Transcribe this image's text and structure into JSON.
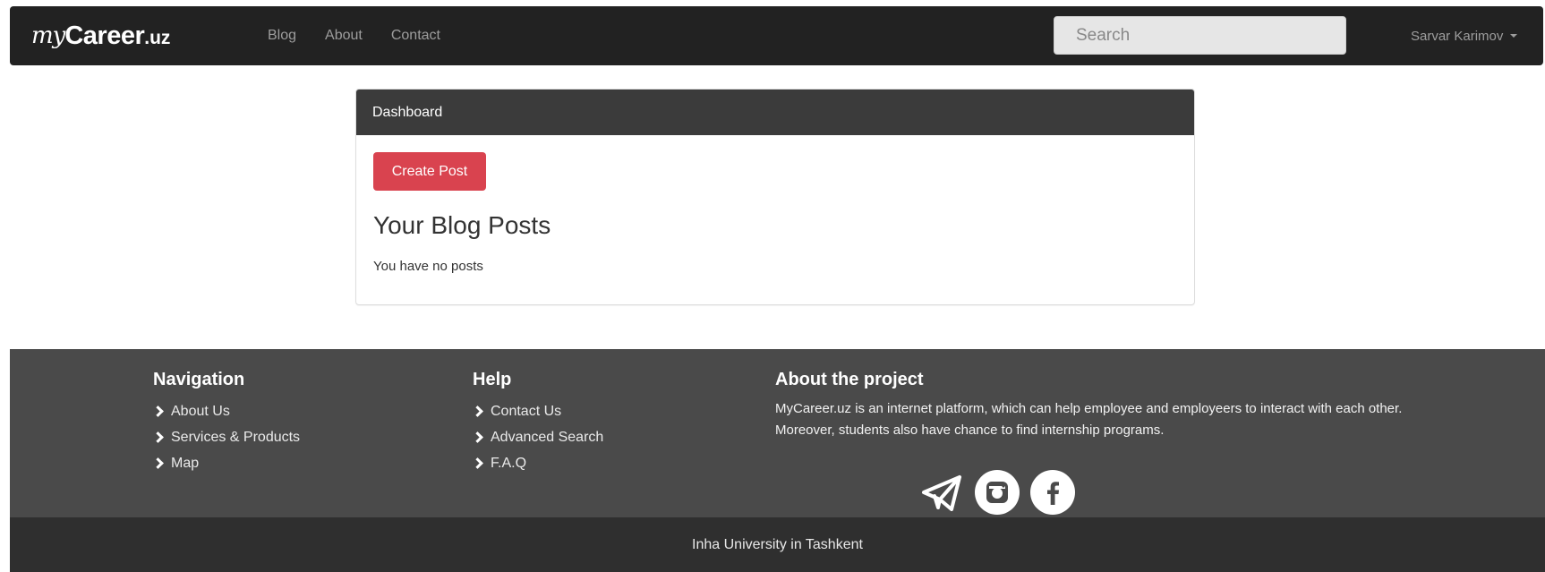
{
  "navbar": {
    "brand": {
      "my": "my",
      "career": "Career",
      "uz": ".uz"
    },
    "links": [
      "Blog",
      "About",
      "Contact"
    ],
    "search_placeholder": "Search",
    "user_name": "Sarvar Karimov"
  },
  "panel": {
    "heading": "Dashboard",
    "create_button": "Create Post",
    "posts_title": "Your Blog Posts",
    "empty_message": "You have no posts"
  },
  "footer": {
    "navigation": {
      "title": "Navigation",
      "items": [
        "About Us",
        "Services & Products",
        "Map"
      ]
    },
    "help": {
      "title": "Help",
      "items": [
        "Contact Us",
        "Advanced Search",
        "F.A.Q"
      ]
    },
    "about": {
      "title": "About the project",
      "text": "MyCareer.uz is an internet platform, which can help employee and employeers to interact with each other. Moreover, students also have chance to find internship programs."
    },
    "social_icons": [
      "telegram-icon",
      "instagram-icon",
      "facebook-icon"
    ],
    "bottom_text": "Inha University in Tashkent"
  },
  "colors": {
    "navbar_bg": "#222222",
    "panel_heading_bg": "#3b3b3b",
    "button_red": "#d9434f",
    "footer_bg": "#4a4a4a",
    "footer_bottom_bg": "#2f2f2f"
  }
}
